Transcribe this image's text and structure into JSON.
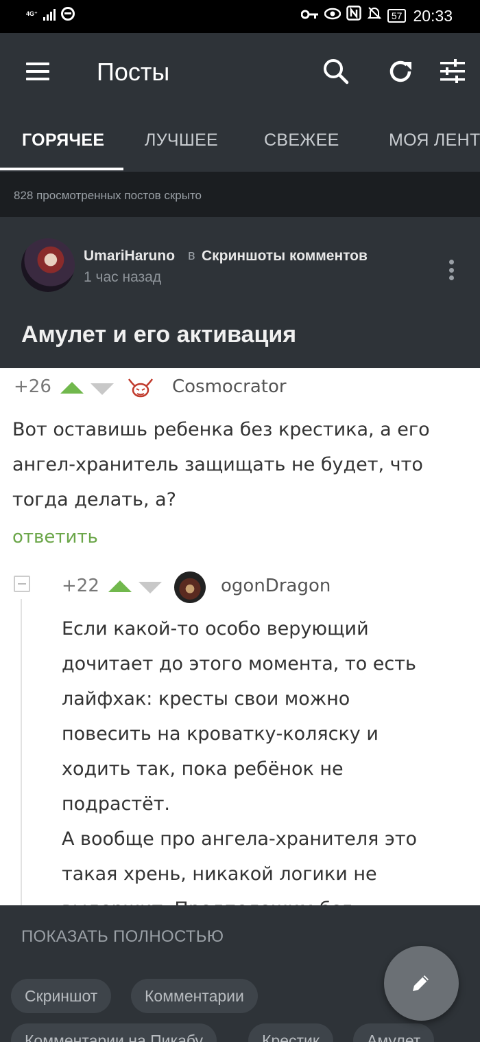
{
  "status_bar": {
    "network": "4G⁺",
    "battery": "57",
    "time": "20:33",
    "icons": [
      "key-icon",
      "eye-icon",
      "nfc-icon",
      "bell-off-icon"
    ]
  },
  "app_bar": {
    "title": "Посты",
    "icons": [
      "menu-icon",
      "search-icon",
      "refresh-icon",
      "filter-icon"
    ]
  },
  "tabs": [
    {
      "label": "ГОРЯЧЕЕ",
      "active": true
    },
    {
      "label": "ЛУЧШЕЕ",
      "active": false
    },
    {
      "label": "СВЕЖЕЕ",
      "active": false
    },
    {
      "label": "МОЯ ЛЕНТ",
      "active": false
    }
  ],
  "hidden_notice": "828 просмотренных постов скрыто",
  "post": {
    "author": "UmariHaruno",
    "in_word": "в",
    "community": "Скриншоты комментов",
    "time": "1 час назад",
    "title": "Амулет и его активация"
  },
  "screenshot": {
    "comment1": {
      "rating": "+26",
      "user": "Cosmocrator",
      "lines": [
        "Вот оставишь ребенка без крестика, а его",
        "ангел-хранитель защищать не будет, что",
        "тогда делать, а?"
      ],
      "reply": "ответить"
    },
    "comment2": {
      "rating": "+22",
      "user": "ogonDragon",
      "lines": [
        "Если какой-то особо верующий",
        "дочитает до этого момента, то есть",
        "лайфхак: кресты свои можно",
        "повесить на кроватку-коляску и",
        "ходить так, пока ребёнок не",
        "подрастёт.",
        "А вообще про ангела-хранителя это",
        "такая хрень, никакой логики не",
        "выдержит. Предположим бог"
      ]
    }
  },
  "show_full": "ПОКАЗАТЬ ПОЛНОСТЬЮ",
  "tags": [
    "Скриншот",
    "Комментарии",
    "Комментарии на Пикабу",
    "Крестик",
    "Амулет"
  ],
  "fab_icon": "pencil-icon",
  "colors": {
    "app_bg": "#2e3338",
    "dark_strip": "#1b1e21",
    "upvote_green": "#71b84d",
    "reply_green": "#6ba649"
  }
}
